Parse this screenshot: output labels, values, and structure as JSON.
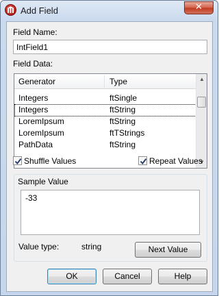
{
  "window": {
    "title": "Add Field",
    "close_glyph": "✕"
  },
  "field_name": {
    "label": "Field Name:",
    "value": "IntField1"
  },
  "field_data": {
    "label": "Field Data:",
    "columns": [
      "Generator",
      "Type"
    ],
    "rows": [
      {
        "generator": "Integers",
        "type": "ftSingle"
      },
      {
        "generator": "Integers",
        "type": "ftString"
      },
      {
        "generator": "LoremIpsum",
        "type": "ftString"
      },
      {
        "generator": "LoremIpsum",
        "type": "ftTStrings"
      },
      {
        "generator": "PathData",
        "type": "ftString"
      }
    ],
    "selected_index": 1
  },
  "options": {
    "shuffle_label": "Shuffle Values",
    "shuffle_checked": true,
    "repeat_label": "Repeat Values",
    "repeat_checked": true
  },
  "sample": {
    "group_label": "Sample Value",
    "value": "-33",
    "type_label": "Value type:",
    "type_value": "string",
    "next_button": "Next Value"
  },
  "buttons": {
    "ok": "OK",
    "cancel": "Cancel",
    "help": "Help"
  },
  "icons": {
    "app": "database-app-icon",
    "check": "check-icon"
  }
}
